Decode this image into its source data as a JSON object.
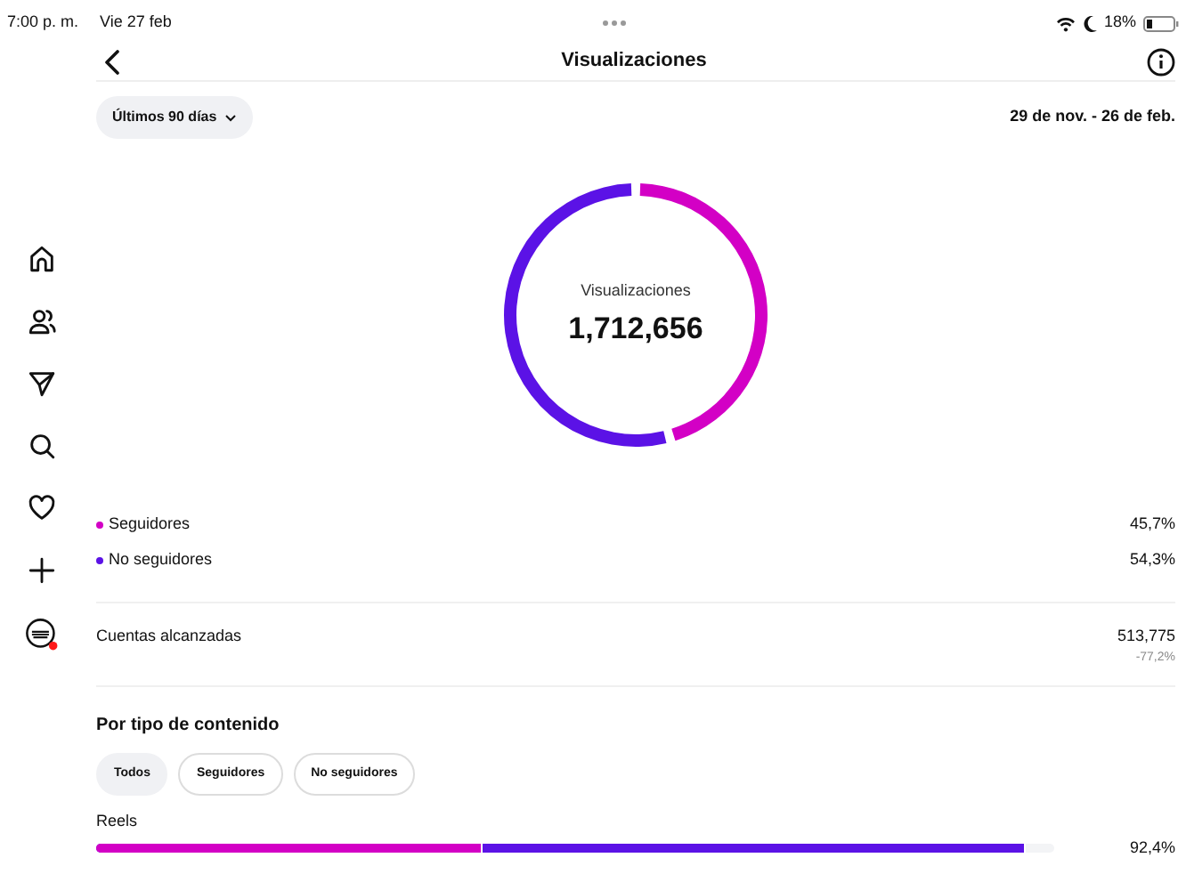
{
  "status_bar": {
    "time": "7:00 p. m.",
    "date": "Vie 27 feb",
    "battery": "18%"
  },
  "header": {
    "title": "Visualizaciones"
  },
  "filter": {
    "period": "Últimos 90 días",
    "date_range": "29 de nov. - 26 de feb."
  },
  "sidebar": {
    "items": [
      {
        "kind": "home"
      },
      {
        "kind": "people"
      },
      {
        "kind": "send"
      },
      {
        "kind": "search"
      },
      {
        "kind": "heart"
      },
      {
        "kind": "plus"
      },
      {
        "kind": "profile"
      }
    ]
  },
  "summary": {
    "total": "1,712,656",
    "chart_data": {
      "type": "donut",
      "categories": [
        "Seguidores",
        "No seguidores"
      ],
      "series": [
        {
          "name": "Visualizaciones",
          "values": [
            45.7,
            54.3
          ]
        }
      ],
      "colors": [
        "#d300c5",
        "#5b12e6"
      ],
      "value_labels": [
        "45,7%",
        "54,3%"
      ]
    }
  },
  "reach": {
    "label": "Cuentas alcanzadas",
    "value": "513,775",
    "change": "-77,2%"
  },
  "content_type": {
    "title": "Por tipo de contenido",
    "tabs": [
      {
        "label": "Todos",
        "selected": true
      },
      {
        "label": "Seguidores",
        "selected": false
      },
      {
        "label": "No seguidores",
        "selected": false
      }
    ],
    "rows": [
      {
        "label": "Reels",
        "value": "92,4%",
        "segments": [
          {
            "level": 0.403,
            "color": "#d300c5"
          },
          {
            "level": 0.97,
            "color": "#5b12e6"
          }
        ]
      }
    ]
  }
}
